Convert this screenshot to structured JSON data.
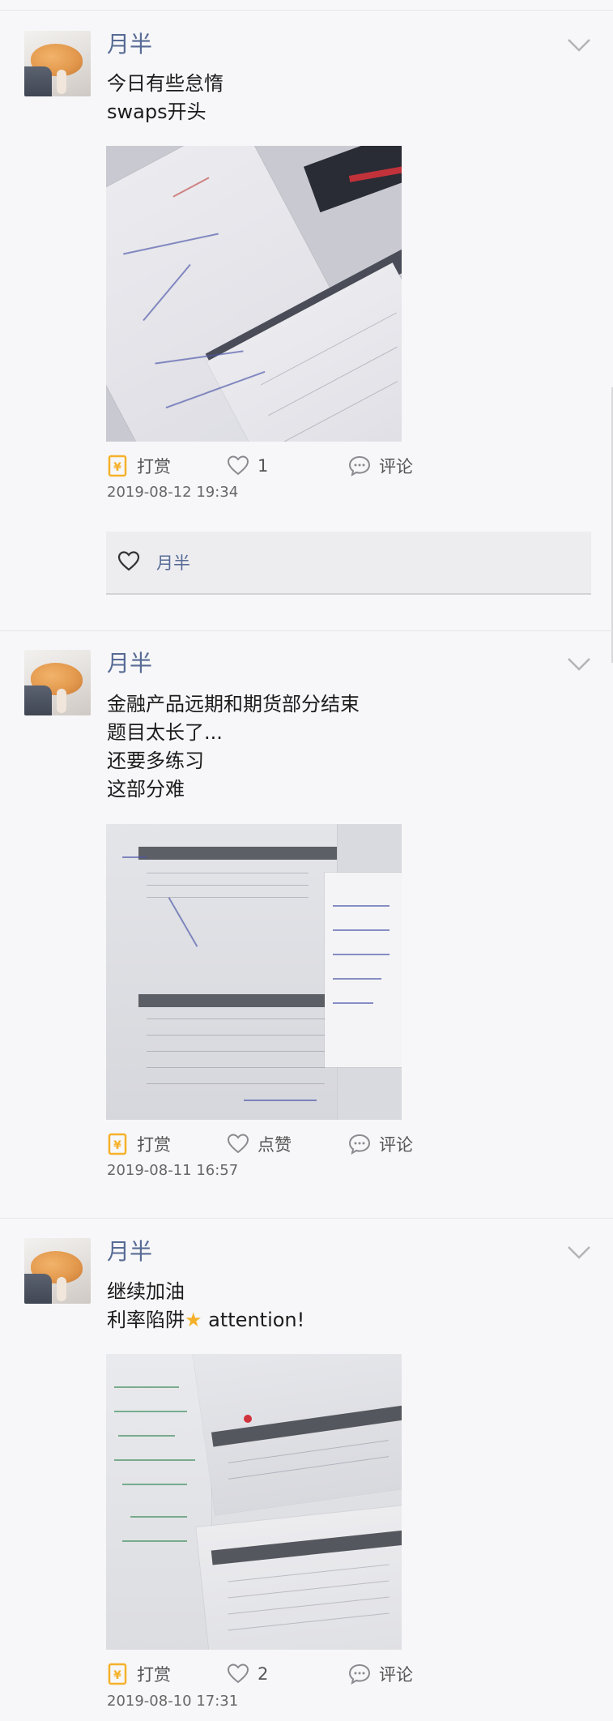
{
  "posts": [
    {
      "username": "月半",
      "lines": [
        "今日有些怠惰",
        "swaps开头"
      ],
      "actions": {
        "reward": "打赏",
        "like": "1",
        "comment": "评论"
      },
      "timestamp": "2019-08-12 19:34",
      "likes": [
        "月半"
      ]
    },
    {
      "username": "月半",
      "lines": [
        "金融产品远期和期货部分结束",
        "题目太长了...",
        "还要多练习",
        "这部分难"
      ],
      "actions": {
        "reward": "打赏",
        "like": "点赞",
        "comment": "评论"
      },
      "timestamp": "2019-08-11 16:57"
    },
    {
      "username": "月半",
      "lines": [
        "继续加油",
        "利率陷阱",
        "attention!"
      ],
      "actions": {
        "reward": "打赏",
        "like": "2",
        "comment": "评论"
      },
      "timestamp": "2019-08-10 17:31"
    }
  ],
  "icons": {
    "avatar": "cat-avatar",
    "menu": "chevron-down-icon",
    "reward": "reward-icon",
    "like": "heart-icon",
    "comment": "comment-icon",
    "sparkle": "sparkle-emoji"
  },
  "colors": {
    "username": "#576b95",
    "reward_icon": "#f5b12a",
    "background": "#f7f7f9"
  }
}
